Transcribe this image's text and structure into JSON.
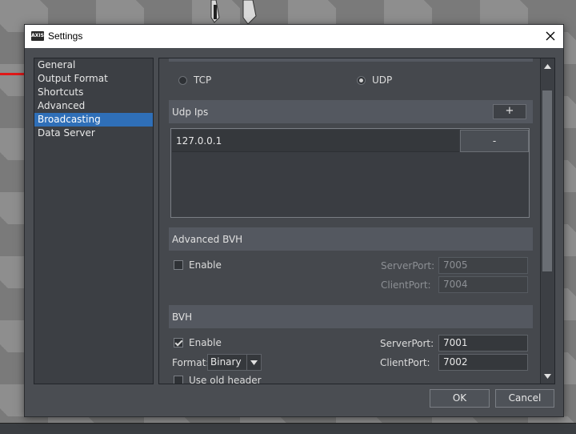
{
  "window": {
    "title": "Settings",
    "app_logo_text": "AXIS"
  },
  "sidebar": {
    "items": [
      {
        "label": "General"
      },
      {
        "label": "Output Format"
      },
      {
        "label": "Shortcuts"
      },
      {
        "label": "Advanced"
      },
      {
        "label": "Broadcasting",
        "selected": true
      },
      {
        "label": "Data Server"
      }
    ]
  },
  "protocol": {
    "tcp_label": "TCP",
    "udp_label": "UDP",
    "selected": "UDP"
  },
  "udp_ips": {
    "header": "Udp Ips",
    "add_label": "+",
    "remove_label": "-",
    "items": [
      "127.0.0.1"
    ]
  },
  "advanced_bvh": {
    "header": "Advanced BVH",
    "enable_label": "Enable",
    "enabled": false,
    "server_port_label": "ServerPort:",
    "server_port": "7005",
    "client_port_label": "ClientPort:",
    "client_port": "7004"
  },
  "bvh": {
    "header": "BVH",
    "enable_label": "Enable",
    "enabled": true,
    "format_label": "Format:",
    "format_value": "Binary",
    "server_port_label": "ServerPort:",
    "server_port": "7001",
    "client_port_label": "ClientPort:",
    "client_port": "7002",
    "use_old_header_label": "Use old header"
  },
  "buttons": {
    "ok": "OK",
    "cancel": "Cancel"
  },
  "colors": {
    "selection": "#2f6fb8",
    "panel": "#4a4d52",
    "red_line": "#e01818"
  }
}
